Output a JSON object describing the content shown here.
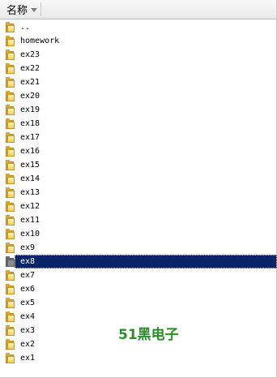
{
  "header": {
    "column_name": "名称"
  },
  "files": [
    {
      "name": ".."
    },
    {
      "name": "homework"
    },
    {
      "name": "ex23"
    },
    {
      "name": "ex22"
    },
    {
      "name": "ex21"
    },
    {
      "name": "ex20"
    },
    {
      "name": "ex19"
    },
    {
      "name": "ex18"
    },
    {
      "name": "ex17"
    },
    {
      "name": "ex16"
    },
    {
      "name": "ex15"
    },
    {
      "name": "ex14"
    },
    {
      "name": "ex13"
    },
    {
      "name": "ex12"
    },
    {
      "name": "ex11"
    },
    {
      "name": "ex10"
    },
    {
      "name": "ex9"
    },
    {
      "name": "ex8",
      "selected": true
    },
    {
      "name": "ex7"
    },
    {
      "name": "ex6"
    },
    {
      "name": "ex5"
    },
    {
      "name": "ex4"
    },
    {
      "name": "ex3"
    },
    {
      "name": "ex2"
    },
    {
      "name": "ex1"
    }
  ],
  "watermark": "51黑电子",
  "colors": {
    "selection": "#0a246a",
    "folder": "#f2cf58",
    "watermark": "#2a8f2a"
  },
  "icons": {
    "folder": "folder-icon",
    "sort": "sort-down-icon"
  }
}
